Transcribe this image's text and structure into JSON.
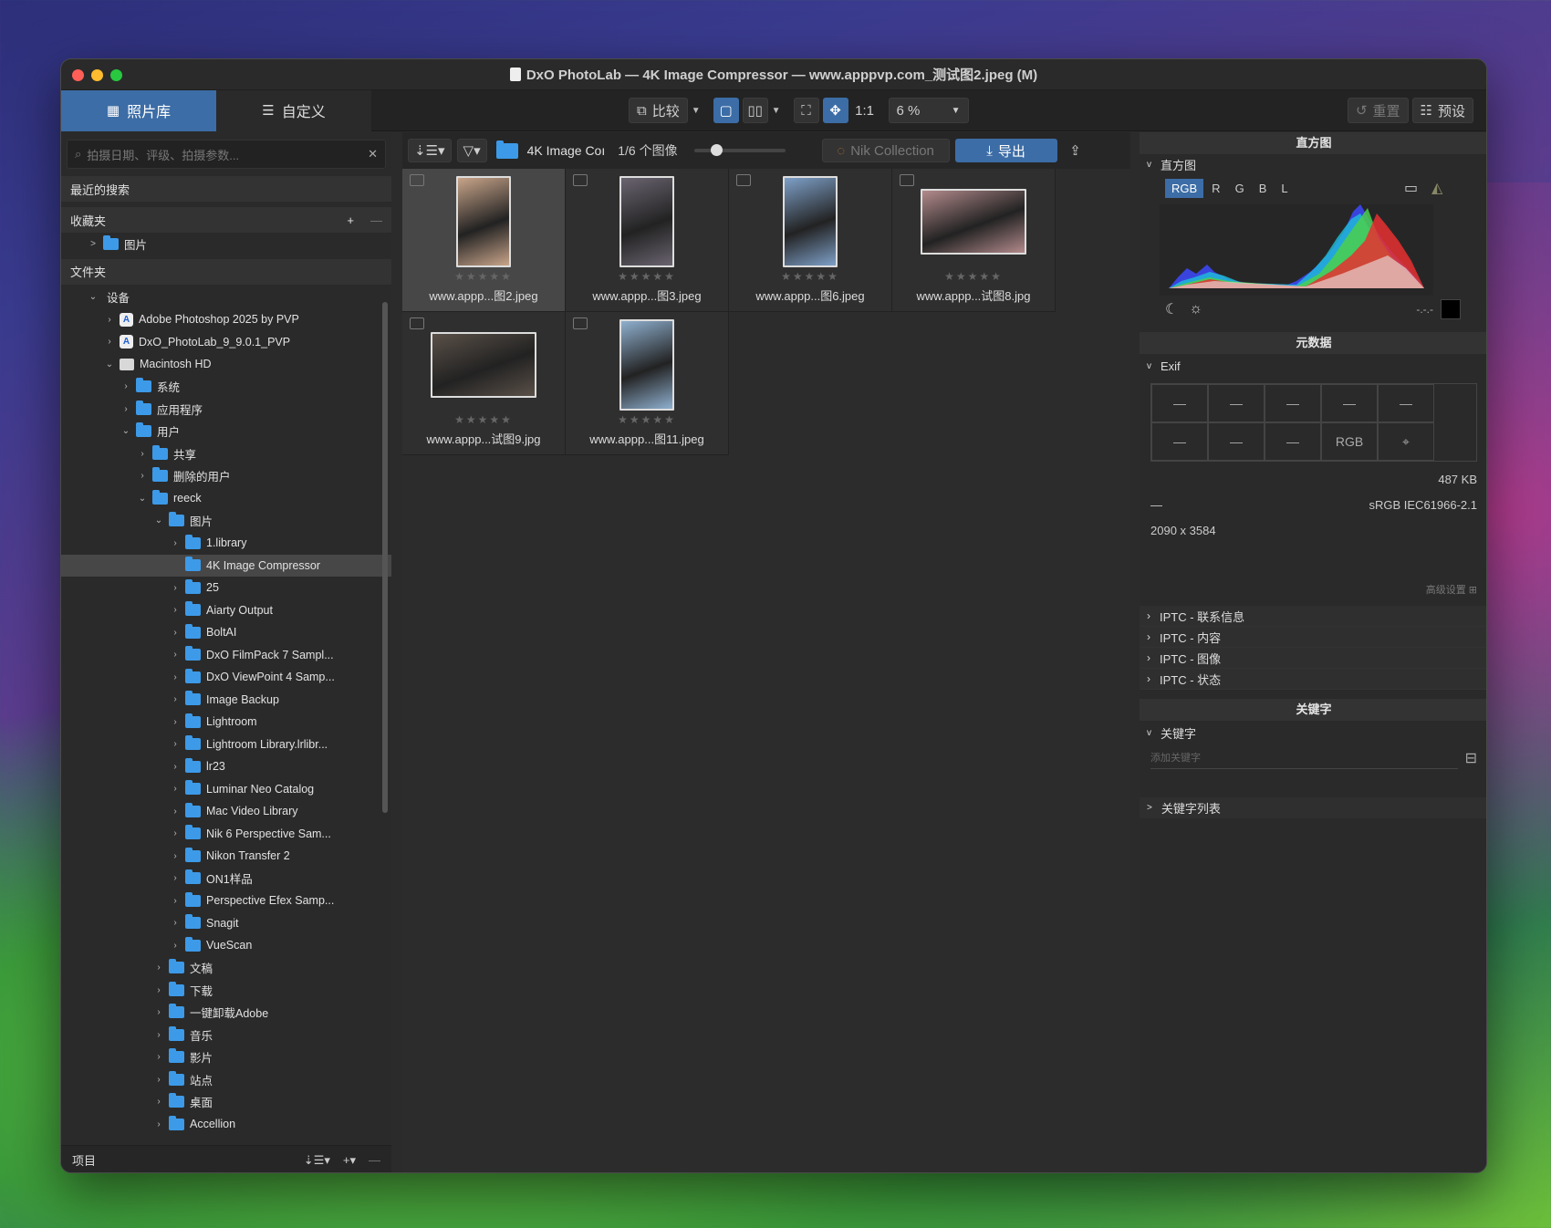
{
  "window": {
    "title": "DxO PhotoLab — 4K Image Compressor — www.apppvp.com_测试图2.jpeg (M)"
  },
  "toolbar": {
    "tab_library": "照片库",
    "tab_customize": "自定义",
    "compare": "比较",
    "zoom_1to1": "1:1",
    "zoom_value": "6 %",
    "reset": "重置",
    "presets": "预设"
  },
  "left": {
    "search_placeholder": "拍摄日期、评级、拍摄参数...",
    "recent_searches": "最近的搜索",
    "favorites": "收藏夹",
    "fav_item": "图片",
    "folders": "文件夹",
    "footer_label": "项目",
    "tree": [
      {
        "label": "设备",
        "indent": 0,
        "chev": "v",
        "icon": "none"
      },
      {
        "label": "Adobe Photoshop 2025 by PVP",
        "indent": 1,
        "chev": ">",
        "icon": "app"
      },
      {
        "label": "DxO_PhotoLab_9_9.0.1_PVP",
        "indent": 1,
        "chev": ">",
        "icon": "app"
      },
      {
        "label": "Macintosh HD",
        "indent": 1,
        "chev": "v",
        "icon": "drive"
      },
      {
        "label": "系统",
        "indent": 2,
        "chev": ">",
        "icon": "folder"
      },
      {
        "label": "应用程序",
        "indent": 2,
        "chev": ">",
        "icon": "folder"
      },
      {
        "label": "用户",
        "indent": 2,
        "chev": "v",
        "icon": "folder"
      },
      {
        "label": "共享",
        "indent": 3,
        "chev": ">",
        "icon": "folder"
      },
      {
        "label": "删除的用户",
        "indent": 3,
        "chev": ">",
        "icon": "folder"
      },
      {
        "label": "reeck",
        "indent": 3,
        "chev": "v",
        "icon": "folder"
      },
      {
        "label": "图片",
        "indent": 4,
        "chev": "v",
        "icon": "folder"
      },
      {
        "label": "1.library",
        "indent": 5,
        "chev": ">",
        "icon": "folder"
      },
      {
        "label": "4K Image Compressor",
        "indent": 5,
        "chev": "",
        "icon": "folder",
        "selected": true
      },
      {
        "label": "25",
        "indent": 5,
        "chev": ">",
        "icon": "folder"
      },
      {
        "label": "Aiarty Output",
        "indent": 5,
        "chev": ">",
        "icon": "folder"
      },
      {
        "label": "BoltAI",
        "indent": 5,
        "chev": ">",
        "icon": "folder"
      },
      {
        "label": "DxO FilmPack 7 Sampl...",
        "indent": 5,
        "chev": ">",
        "icon": "folder"
      },
      {
        "label": "DxO ViewPoint 4 Samp...",
        "indent": 5,
        "chev": ">",
        "icon": "folder"
      },
      {
        "label": "Image Backup",
        "indent": 5,
        "chev": ">",
        "icon": "folder"
      },
      {
        "label": "Lightroom",
        "indent": 5,
        "chev": ">",
        "icon": "folder"
      },
      {
        "label": "Lightroom Library.lrlibr...",
        "indent": 5,
        "chev": ">",
        "icon": "folder"
      },
      {
        "label": "lr23",
        "indent": 5,
        "chev": ">",
        "icon": "folder"
      },
      {
        "label": "Luminar Neo Catalog",
        "indent": 5,
        "chev": ">",
        "icon": "folder"
      },
      {
        "label": "Mac Video Library",
        "indent": 5,
        "chev": ">",
        "icon": "folder"
      },
      {
        "label": "Nik 6 Perspective Sam...",
        "indent": 5,
        "chev": ">",
        "icon": "folder"
      },
      {
        "label": "Nikon Transfer 2",
        "indent": 5,
        "chev": ">",
        "icon": "folder"
      },
      {
        "label": "ON1样品",
        "indent": 5,
        "chev": ">",
        "icon": "folder"
      },
      {
        "label": "Perspective Efex Samp...",
        "indent": 5,
        "chev": ">",
        "icon": "folder"
      },
      {
        "label": "Snagit",
        "indent": 5,
        "chev": ">",
        "icon": "folder"
      },
      {
        "label": "VueScan",
        "indent": 5,
        "chev": ">",
        "icon": "folder"
      },
      {
        "label": "文稿",
        "indent": 4,
        "chev": ">",
        "icon": "folder"
      },
      {
        "label": "下载",
        "indent": 4,
        "chev": ">",
        "icon": "folder"
      },
      {
        "label": "一键卸载Adobe",
        "indent": 4,
        "chev": ">",
        "icon": "folder"
      },
      {
        "label": "音乐",
        "indent": 4,
        "chev": ">",
        "icon": "folder"
      },
      {
        "label": "影片",
        "indent": 4,
        "chev": ">",
        "icon": "folder"
      },
      {
        "label": "站点",
        "indent": 4,
        "chev": ">",
        "icon": "folder"
      },
      {
        "label": "桌面",
        "indent": 4,
        "chev": ">",
        "icon": "folder"
      },
      {
        "label": "Accellion",
        "indent": 4,
        "chev": ">",
        "icon": "folder"
      }
    ]
  },
  "center": {
    "folder_name": "4K Image Coı",
    "count": "1/6 个图像",
    "nik_collection": "Nik Collection",
    "export": "导出",
    "images": [
      {
        "name": "www.appp...图2.jpeg",
        "selected": true,
        "thumb_color": "#c9a58a",
        "portrait": true
      },
      {
        "name": "www.appp...图3.jpeg",
        "thumb_color": "#6a6470",
        "portrait": true
      },
      {
        "name": "www.appp...图6.jpeg",
        "thumb_color": "#7ea0c8",
        "portrait": true
      },
      {
        "name": "www.appp...试图8.jpg",
        "thumb_color": "#b38a8c",
        "portrait": false
      },
      {
        "name": "www.appp...试图9.jpg",
        "thumb_color": "#5a5048",
        "portrait": false
      },
      {
        "name": "www.appp...图11.jpeg",
        "thumb_color": "#8fb0cf",
        "portrait": true
      }
    ]
  },
  "right": {
    "histogram_title": "直方图",
    "histogram_sub": "直方图",
    "channels": [
      "RGB",
      "R",
      "G",
      "B",
      "L"
    ],
    "histo_readout": "-.-.-",
    "metadata_title": "元数据",
    "exif_label": "Exif",
    "exif_cells": [
      "—",
      "—",
      "—",
      "—",
      "—",
      "—",
      "—",
      "—",
      "RGB",
      ""
    ],
    "file_size": "487 KB",
    "dash": "—",
    "color_profile": "sRGB IEC61966-2.1",
    "dimensions": "2090 x 3584",
    "advanced": "高级设置",
    "iptc": [
      "IPTC - 联系信息",
      "IPTC - 内容",
      "IPTC - 图像",
      "IPTC - 状态"
    ],
    "keywords_title": "关键字",
    "keywords_sub": "关键字",
    "keyword_placeholder": "添加关键字",
    "keyword_list": "关键字列表"
  }
}
